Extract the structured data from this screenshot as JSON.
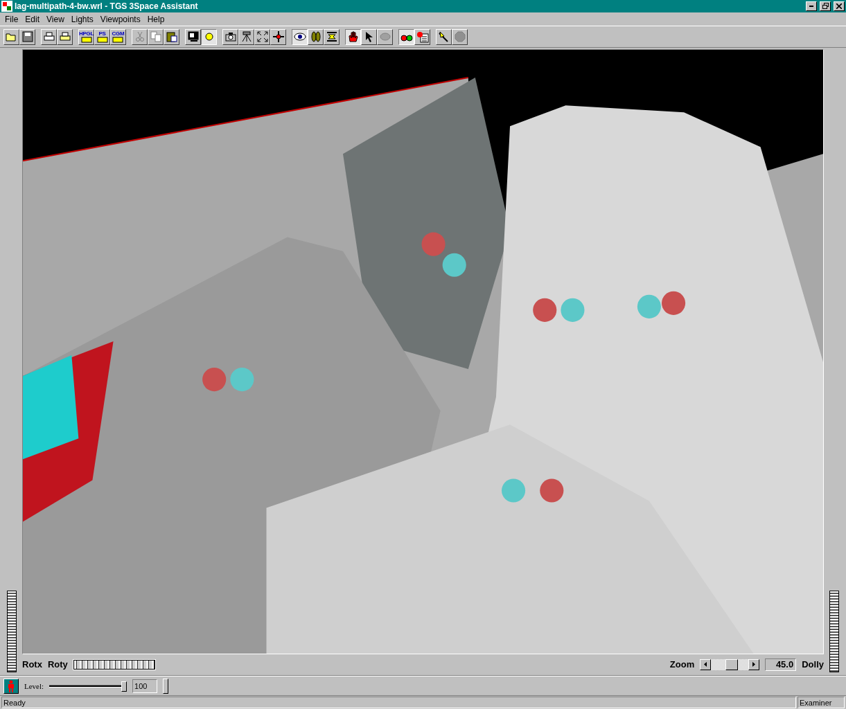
{
  "window": {
    "title": "lag-multipath-4-bw.wrl - TGS 3Space Assistant"
  },
  "menu": [
    "File",
    "Edit",
    "View",
    "Lights",
    "Viewpoints",
    "Help"
  ],
  "toolbar": [
    [
      {
        "kind": "open",
        "pressed": false,
        "disabled": false
      },
      {
        "kind": "save",
        "pressed": false,
        "disabled": false
      }
    ],
    [
      {
        "kind": "print",
        "pressed": false,
        "disabled": false
      },
      {
        "kind": "printsetup",
        "pressed": false,
        "disabled": false
      }
    ],
    [
      {
        "kind": "export",
        "label": "HPGL",
        "pressed": false,
        "disabled": false
      },
      {
        "kind": "export",
        "label": "PS",
        "pressed": false,
        "disabled": false
      },
      {
        "kind": "export",
        "label": "CGM",
        "pressed": false,
        "disabled": false
      }
    ],
    [
      {
        "kind": "cut",
        "pressed": false,
        "disabled": true
      },
      {
        "kind": "copy",
        "pressed": false,
        "disabled": true
      },
      {
        "kind": "paste",
        "pressed": false,
        "disabled": false
      }
    ],
    [
      {
        "kind": "monitor",
        "pressed": false,
        "disabled": false
      },
      {
        "kind": "sun",
        "pressed": true,
        "disabled": false
      }
    ],
    [
      {
        "kind": "camera",
        "pressed": false,
        "disabled": false
      },
      {
        "kind": "tripod",
        "pressed": false,
        "disabled": false
      },
      {
        "kind": "fit",
        "pressed": false,
        "disabled": false
      },
      {
        "kind": "target",
        "pressed": false,
        "disabled": false
      }
    ],
    [
      {
        "kind": "eye",
        "pressed": true,
        "disabled": false
      },
      {
        "kind": "footprints",
        "pressed": false,
        "disabled": false
      },
      {
        "kind": "planes",
        "pressed": false,
        "disabled": false
      }
    ],
    [
      {
        "kind": "hand",
        "pressed": true,
        "disabled": false
      },
      {
        "kind": "arrow",
        "pressed": false,
        "disabled": false
      },
      {
        "kind": "blob",
        "pressed": false,
        "disabled": true
      }
    ],
    [
      {
        "kind": "glasses",
        "pressed": true,
        "disabled": false
      },
      {
        "kind": "list",
        "pressed": false,
        "disabled": false
      }
    ],
    [
      {
        "kind": "wand",
        "pressed": false,
        "disabled": false
      },
      {
        "kind": "stop",
        "pressed": false,
        "disabled": true
      }
    ]
  ],
  "viewer": {
    "rotx_label": "Rotx",
    "roty_label": "Roty",
    "zoom_label": "Zoom",
    "zoom": {
      "level": 0.55
    },
    "zoom_value": "45.0",
    "dolly_label": "Dolly"
  },
  "level_bar": {
    "label": "Level:",
    "slider": {
      "level": 1
    },
    "value": "100"
  },
  "status_bar": {
    "message": "Ready",
    "mode": "Examiner"
  }
}
